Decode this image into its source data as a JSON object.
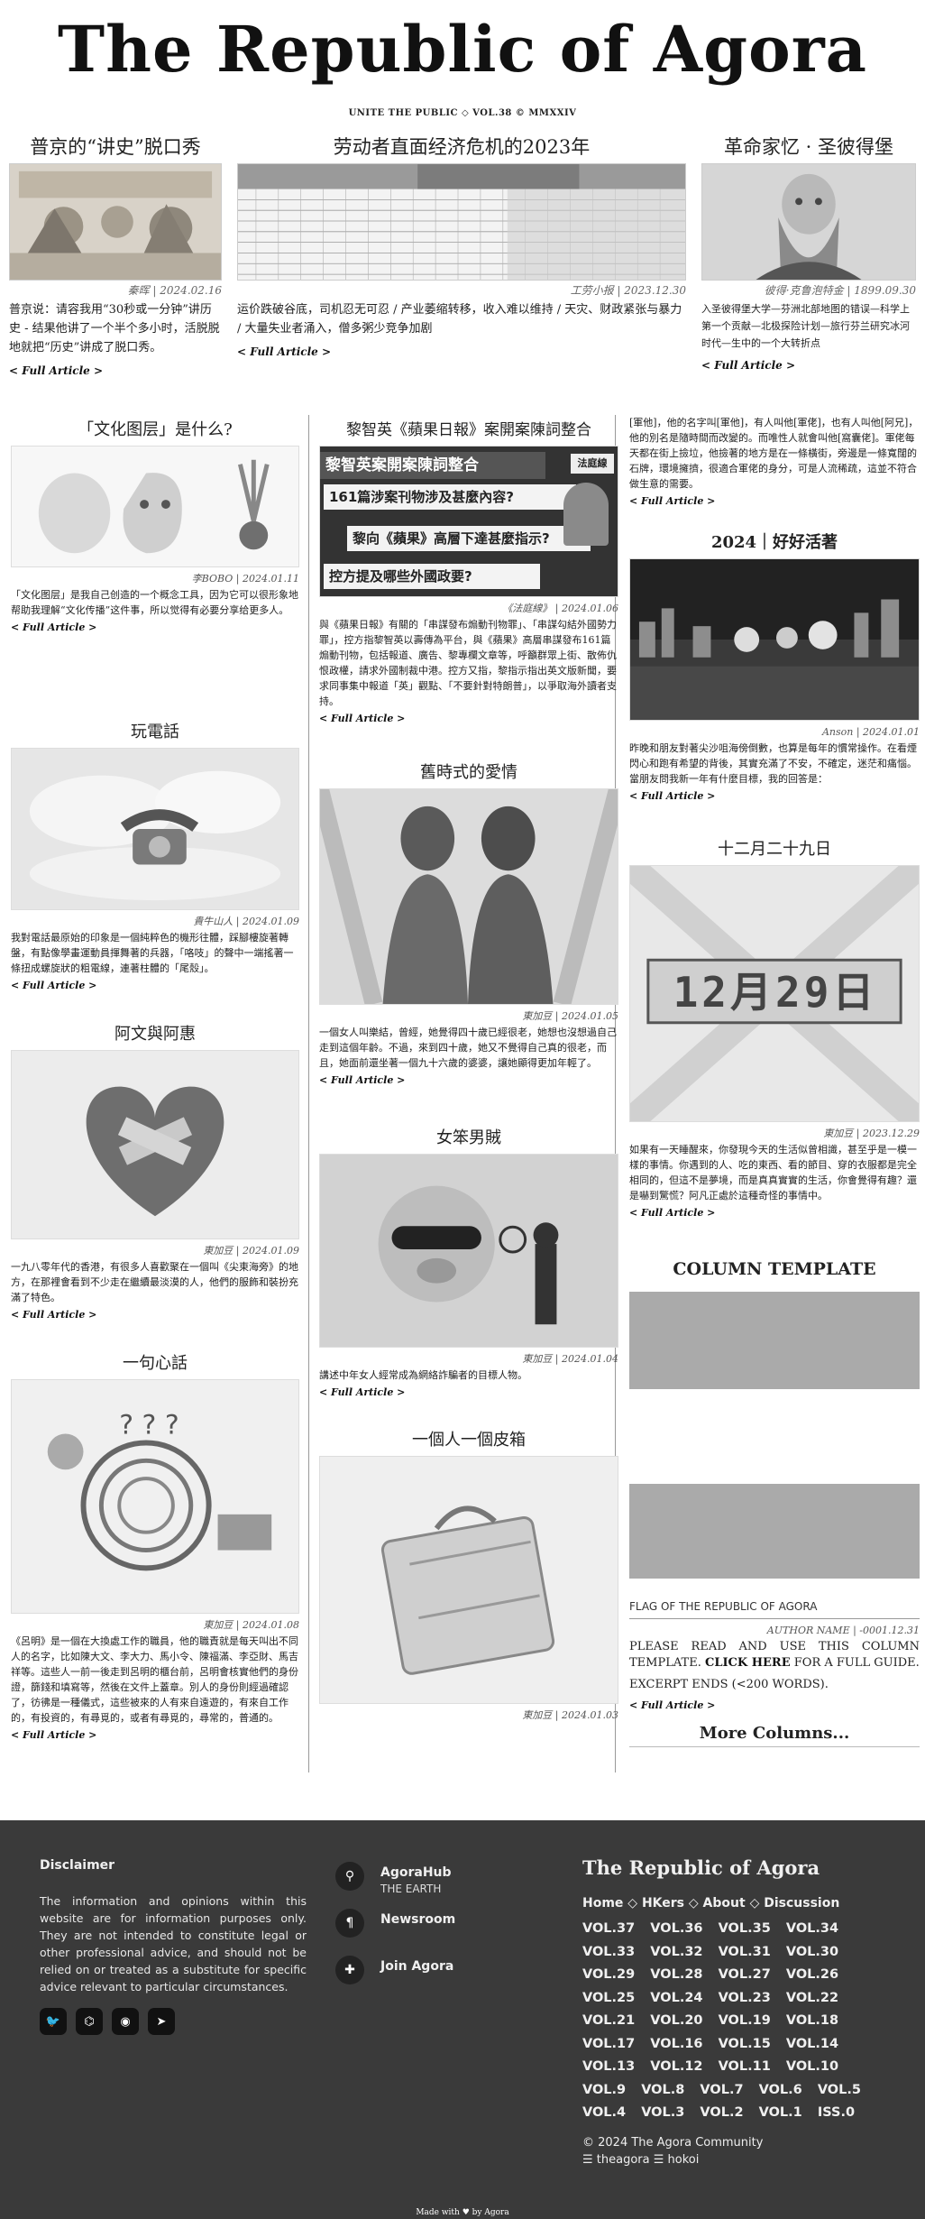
{
  "masthead": {
    "title": "The Republic of Agora",
    "subtitle": "UNITE THE PUBLIC ◇ VOL.38 © MMXXIV"
  },
  "top": [
    {
      "title": "普京的“讲史”脱口秀",
      "caption": "秦晖 | 2024.02.16",
      "excerpt": "普京说：请容我用“30秒或一分钟”讲历史 - 结果他讲了一个半个多小时，活脱脱地就把“历史”讲成了脱口秀。",
      "more": "< Full Article >"
    },
    {
      "title": "劳动者直面经济危机的2023年",
      "caption": "工劳小报 | 2023.12.30",
      "excerpt": "运价跌破谷底，司机忍无可忍 / 产业萎缩转移，收入难以维持 / 天灾、财政紧张与暴力 / 大量失业者涌入，僧多粥少竞争加剧",
      "more": "< Full Article >"
    },
    {
      "title": "革命家忆 · 圣彼得堡",
      "caption": "彼得·克鲁泡特金 | 1899.09.30",
      "excerpt": "入圣彼得堡大学—芬洲北部地图的错误—科学上第一个贡献—北极探险计划—旅行芬兰研究冰河时代—生中的一个大转折点",
      "more": "< Full Article >"
    }
  ],
  "col1": [
    {
      "title": "「文化图层」是什么?",
      "caption": "李BOBO | 2024.01.11",
      "excerpt": "「文化图层」是我自己创造的一个概念工具，因为它可以很形象地帮助我理解“文化传播”这件事，所以觉得有必要分享给更多人。",
      "more": "< Full Article >"
    },
    {
      "title": "玩電話",
      "caption": "貴牛山人 | 2024.01.09",
      "excerpt": "我對電話最原始的印象是一個純粹色的機形往體，踩腳樓旋著轉盤，有點像學畫運動員揮舞著的兵器，「咯吱」的聲中一端搖著一條扭成螺旋狀的粗電線，連著柱體的「尾殼」。",
      "more": "< Full Article >"
    },
    {
      "title": "阿文與阿惠",
      "caption": "東加豆 | 2024.01.09",
      "excerpt": "一九八零年代的香港，有很多人喜歡聚在一個叫《尖東海旁》的地方，在那裡會看到不少走在繼續最淡漠的人，他們的服飾和裝扮充滿了特色。",
      "more": "< Full Article >"
    },
    {
      "title": "一句心話",
      "caption": "東加豆 | 2024.01.08",
      "excerpt": "《呂明》是一個在大換處工作的職員，他的職責就是每天叫出不同人的名字，比如陳大文、李大力、馬小令、陳福滿、李亞財、馬吉祥等。這些人一前一後走到呂明的櫃台前，呂明會核實他們的身份證，篩錢和填寫等，然後在文件上蓋章。別人的身份則經過確認了，彷彿是一種儀式，這些被來的人有來自遠遊的，有來自工作的，有投資的，有尋覓的，或者有尋覓的，尋常的，普通的。",
      "more": "< Full Article >"
    }
  ],
  "col2": [
    {
      "title": "黎智英《蘋果日報》案開案陳詞整合",
      "caption": "《法庭線》 | 2024.01.06",
      "excerpt": "與《蘋果日報》有關的「串謀發布煽動刊物罪」、「串謀勾結外國勢力罪」，控方指黎智英以壽傳為平台，與《蘋果》高層串謀發布161篇煽動刊物，包括報道、廣告、黎專欄文章等，呼籲群眾上街、散佈仇恨政權，請求外國制裁中港。控方又指，黎指示指出英文版新聞，要求同事集中報道「英」觀點、「不要針對特朗普」，以爭取海外讀者支持。",
      "more": "< Full Article >",
      "img_text": [
        "黎智英案開案陳詞整合",
        "161篇涉案刊物涉及甚麼內容?",
        "黎向《蘋果》高層下達甚麼指示?",
        "控方提及哪些外國政要?",
        "法庭線"
      ]
    },
    {
      "title": "舊時式的愛情",
      "caption": "東加豆 | 2024.01.05",
      "excerpt": "一個女人叫樂結，曾經，她覺得四十歲已經很老，她想也沒想過自己走到這個年齡。不過，來到四十歲，她又不覺得自己真的很老，而且，她面前還坐著一個九十六歲的婆婆，讓她顯得更加年輕了。",
      "more": "< Full Article >"
    },
    {
      "title": "女笨男賊",
      "caption": "東加豆 | 2024.01.04",
      "excerpt": "講述中年女人經常成為網絡詐騙者的目標人物。",
      "more": "< Full Article >"
    },
    {
      "title": "一個人一個皮箱",
      "caption": "東加豆 | 2024.01.03",
      "excerpt": "",
      "more": ""
    }
  ],
  "col3": {
    "lead": {
      "excerpt": "[軍他]，他的名字叫[軍他]，有人叫他[軍佬]，也有人叫他[阿兄]，他的別名是隨時間而改變的。而唯性人就會叫他[窩囊佬]。軍佬每天都在街上撿垃，他撿著的地方是在一條橫街，旁邊是一條寬闊的石牌，環境擁擠，很適合軍佬的身分，可是人流稀疏，這並不符合做生意的需要。",
      "more": "< Full Article >"
    },
    "items": [
      {
        "title": "2024｜好好活著",
        "caption": "Anson | 2024.01.01",
        "excerpt": "昨晚和朋友對著尖沙咀海傍倒數，也算是每年的慣常操作。在看煙閃心和跑有希望的背後，其實充滿了不安，不確定，迷茫和痛惱。當朋友問我新一年有什麼目標，我的回答是：",
        "more": "< Full Article >"
      },
      {
        "title": "十二月二十九日",
        "caption": "東加豆 | 2023.12.29",
        "excerpt": "如果有一天睡醒來，你發現今天的生活似曾相識，甚至乎是一模一樣的事情。你遇到的人、吃的東西、看的節目、穿的衣服都是完全相同的，但這不是夢境，而是真真實實的生活，你會覺得有趣？還是嚇到驚慌？阿凡正處於這種奇怪的事情中。",
        "more": "< Full Article >",
        "img_text": "12月29日"
      }
    ],
    "template": {
      "title": "COLUMN TEMPLATE",
      "flag_caption": "FLAG OF THE REPUBLIC OF AGORA",
      "author": "AUTHOR NAME | -0001.12.31",
      "excerpt_a": "PLEASE READ AND USE THIS COLUMN TEMPLATE.",
      "excerpt_link": "CLICK HERE",
      "excerpt_b": "FOR A FULL GUIDE.",
      "excerpt_c": "EXCERPT ENDS (<200 WORDS).",
      "more": "< Full Article >"
    },
    "more_columns": "More Columns..."
  },
  "footer": {
    "disclaimer_title": "Disclaimer",
    "disclaimer_text": "The information and opinions within this website are for information purposes only. They are not intended to constitute legal or other professional advice, and should not be relied on or treated as a substitute for specific advice relevant to particular circumstances.",
    "social": [
      {
        "icon": "twitter-icon",
        "glyph": "🐦"
      },
      {
        "icon": "github-icon",
        "glyph": "⌬"
      },
      {
        "icon": "reddit-icon",
        "glyph": "◉"
      },
      {
        "icon": "telegram-icon",
        "glyph": "➤"
      }
    ],
    "links": [
      {
        "icon": "map-pin-icon",
        "glyph": "⚲",
        "label": "AgoraHub",
        "sub": "THE EARTH"
      },
      {
        "icon": "pilcrow-icon",
        "glyph": "¶",
        "label": "Newsroom",
        "sub": ""
      },
      {
        "icon": "puzzle-icon",
        "glyph": "✚",
        "label": "Join Agora",
        "sub": ""
      }
    ],
    "brand": "The Republic of Agora",
    "menu": [
      "Home",
      "HKers",
      "About",
      "Discussion"
    ],
    "menu_sep": "◇",
    "volumes": [
      "VOL.37",
      "VOL.36",
      "VOL.35",
      "VOL.34",
      "VOL.33",
      "VOL.32",
      "VOL.31",
      "VOL.30",
      "VOL.29",
      "VOL.28",
      "VOL.27",
      "VOL.26",
      "VOL.25",
      "VOL.24",
      "VOL.23",
      "VOL.22",
      "VOL.21",
      "VOL.20",
      "VOL.19",
      "VOL.18",
      "VOL.17",
      "VOL.16",
      "VOL.15",
      "VOL.14",
      "VOL.13",
      "VOL.12",
      "VOL.11",
      "VOL.10",
      "VOL.9",
      "VOL.8",
      "VOL.7",
      "VOL.6",
      "VOL.5",
      "VOL.4",
      "VOL.3",
      "VOL.2",
      "VOL.1",
      "ISS.0"
    ],
    "copyright": "© 2024 The Agora Community",
    "credits": "☰ theagora ☰ hokoi",
    "made_with": "Made with ♥ by Agora"
  }
}
